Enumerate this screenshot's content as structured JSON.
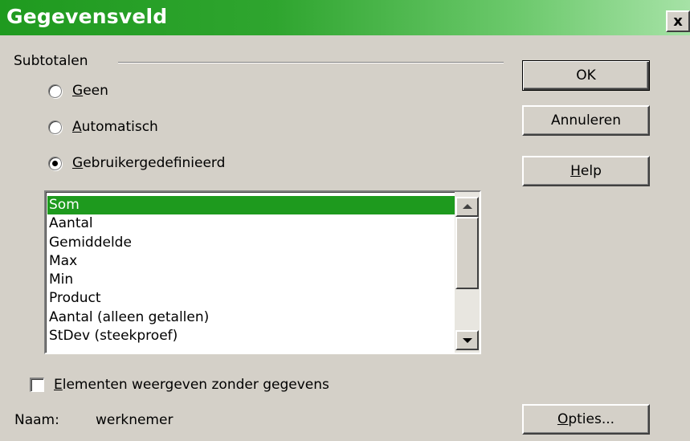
{
  "window": {
    "title": "Gegevensveld",
    "close_label": "x"
  },
  "subtotals": {
    "group_label": "Subtotalen",
    "options": [
      {
        "label": "Geen",
        "mnemonic": "G",
        "rest": "een",
        "checked": false
      },
      {
        "label": "Automatisch",
        "mnemonic": "A",
        "rest": "utomatisch",
        "checked": false
      },
      {
        "label": "Gebruikergedefinieerd",
        "mnemonic": "G",
        "rest": "ebruikergedefinieerd",
        "checked": true
      }
    ],
    "list": {
      "selected": "Som",
      "items": [
        "Som",
        "Aantal",
        "Gemiddelde",
        "Max",
        "Min",
        "Product",
        "Aantal (alleen getallen)",
        "StDev (steekproef)"
      ]
    }
  },
  "show_empty": {
    "label": "Elementen weergeven zonder gegevens",
    "mnemonic": "E",
    "rest": "lementen weergeven zonder gegevens",
    "checked": false
  },
  "name": {
    "label": "Naam:",
    "value": "werknemer"
  },
  "buttons": {
    "ok": "OK",
    "cancel": "Annuleren",
    "help": {
      "label": "Help",
      "mnemonic": "H",
      "rest": "elp"
    },
    "options": {
      "label": "Opties...",
      "mnemonic": "O",
      "rest": "pties..."
    }
  },
  "colors": {
    "title_start": "#1f9a1f",
    "title_end": "#a6e2a6",
    "selection": "#1e9a1e",
    "dialog_bg": "#d4d0c8"
  }
}
